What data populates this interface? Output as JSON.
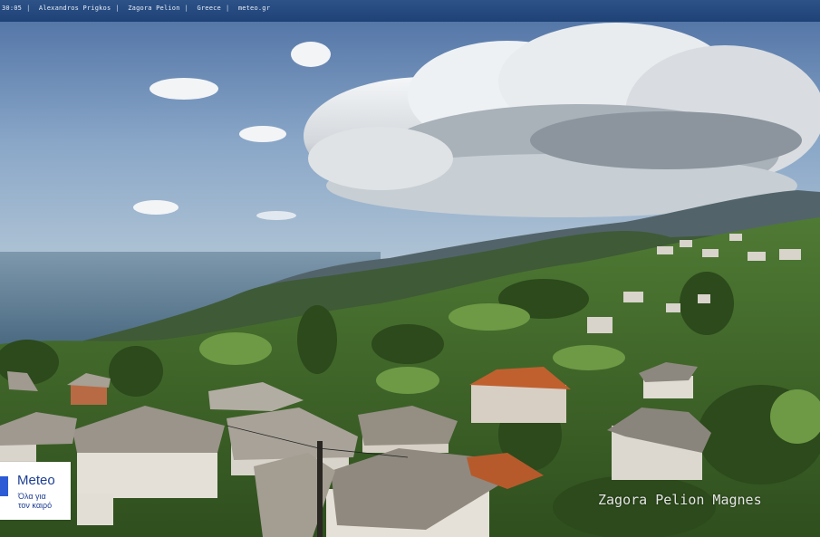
{
  "header": {
    "time": "30:05",
    "photographer": "Alexandros Prigkos",
    "location": "Zagora Pelion",
    "country": "Greece",
    "site": "meteo.gr",
    "separator": "|"
  },
  "logo": {
    "name": "Meteo",
    "tagline_line1": "Όλα για",
    "tagline_line2": "τον καιρό"
  },
  "watermark": {
    "text": "Zagora Pelion Magnes"
  },
  "colors": {
    "header_bar": "#1f4276",
    "logo_blue": "#2d5bd6",
    "sky": "#6f8fb6",
    "sea": "#5b7a95"
  }
}
